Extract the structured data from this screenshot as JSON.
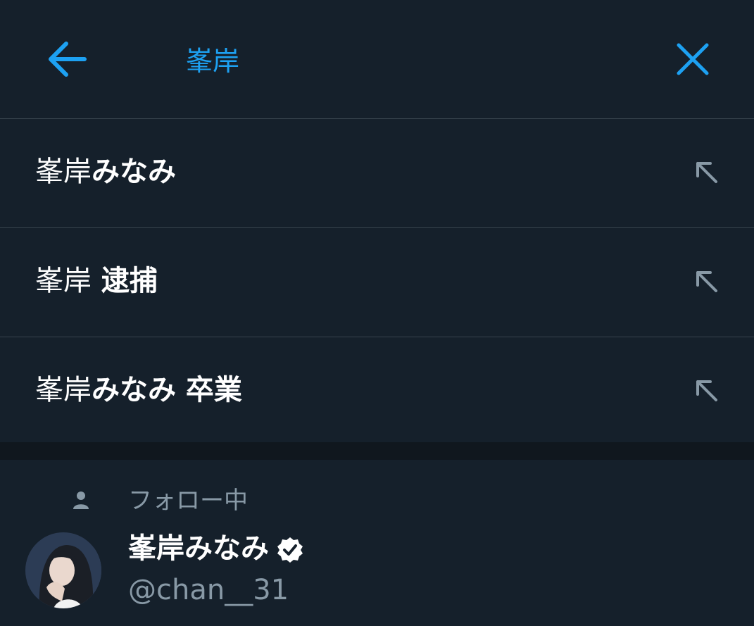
{
  "search": {
    "query": "峯岸",
    "back_icon": "arrow-left-icon",
    "clear_icon": "close-icon",
    "accent_color": "#1da1f2"
  },
  "suggestions": [
    {
      "query_part": "峯岸",
      "rest": "みなみ",
      "icon": "arrow-up-left-icon"
    },
    {
      "query_part": "峯岸",
      "rest": " 逮捕",
      "icon": "arrow-up-left-icon"
    },
    {
      "query_part": "峯岸",
      "rest": "みなみ 卒業",
      "icon": "arrow-up-left-icon"
    }
  ],
  "people": {
    "section_label": "フォロー中",
    "section_icon": "person-icon",
    "user": {
      "name": "峯岸みなみ",
      "handle": "@chan__31",
      "verified_icon": "verified-badge-icon"
    }
  },
  "colors": {
    "background": "#15202b",
    "separator": "#38444d",
    "secondary_text": "#8899a6",
    "primary_text": "#ffffff"
  }
}
